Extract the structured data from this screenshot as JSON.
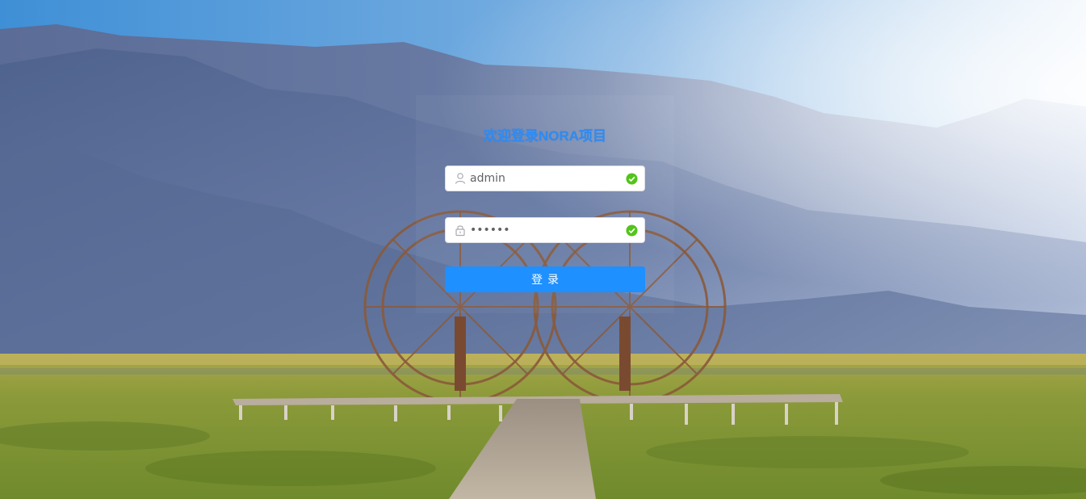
{
  "login": {
    "title": "欢迎登录NORA项目",
    "username": {
      "value": "admin",
      "prefix_icon": "user-icon",
      "suffix_icon": "check-circle-icon"
    },
    "password": {
      "value": "123456",
      "prefix_icon": "lock-icon",
      "suffix_icon": "check-circle-icon"
    },
    "submit_label": "登录"
  },
  "colors": {
    "accent": "#1e90ff",
    "title": "#2f8bf0",
    "valid": "#52c41a"
  },
  "background": {
    "description_icon": "landscape-waterwheel-background"
  }
}
